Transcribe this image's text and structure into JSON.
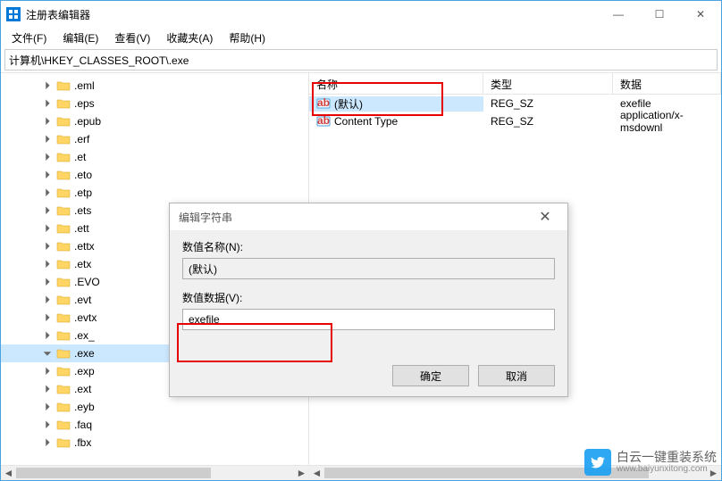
{
  "window": {
    "title": "注册表编辑器",
    "controls": {
      "min": "—",
      "max": "☐",
      "close": "✕"
    }
  },
  "menubar": [
    "文件(F)",
    "编辑(E)",
    "查看(V)",
    "收藏夹(A)",
    "帮助(H)"
  ],
  "address": "计算机\\HKEY_CLASSES_ROOT\\.exe",
  "tree": [
    ".eml",
    ".eps",
    ".epub",
    ".erf",
    ".et",
    ".eto",
    ".etp",
    ".ets",
    ".ett",
    ".ettx",
    ".etx",
    ".EVO",
    ".evt",
    ".evtx",
    ".ex_",
    ".exe",
    ".exp",
    ".ext",
    ".eyb",
    ".faq",
    ".fbx"
  ],
  "tree_selected": ".exe",
  "list": {
    "headers": {
      "name": "名称",
      "type": "类型",
      "data": "数据"
    },
    "rows": [
      {
        "name": "(默认)",
        "type": "REG_SZ",
        "data": "exefile",
        "selected": true
      },
      {
        "name": "Content Type",
        "type": "REG_SZ",
        "data": "application/x-msdownl",
        "selected": false
      }
    ]
  },
  "dialog": {
    "title": "编辑字符串",
    "name_label": "数值名称(N):",
    "name_value": "(默认)",
    "data_label": "数值数据(V):",
    "data_value": "exefile",
    "ok": "确定",
    "cancel": "取消"
  },
  "watermark": {
    "line1": "白云一键重装系统",
    "line2": "www.baiyunxitong.com"
  }
}
